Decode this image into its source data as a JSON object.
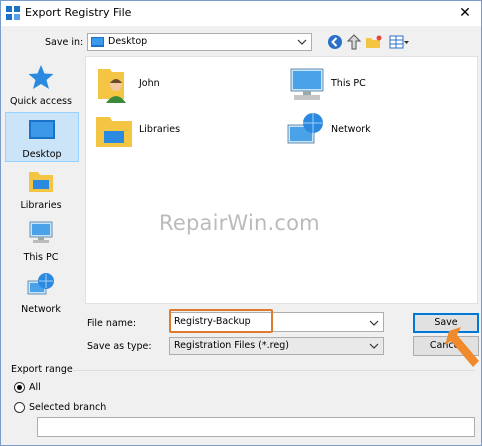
{
  "window": {
    "title": "Export Registry File",
    "close_glyph": "✕"
  },
  "toolbar": {
    "save_in_label": "Save in:",
    "save_in_value": "Desktop",
    "icons": [
      "back-icon",
      "up-folder-icon",
      "new-folder-icon",
      "view-menu-icon"
    ]
  },
  "places": [
    {
      "label": "Quick access",
      "icon": "star-icon"
    },
    {
      "label": "Desktop",
      "icon": "desktop-icon",
      "selected": true
    },
    {
      "label": "Libraries",
      "icon": "libraries-icon"
    },
    {
      "label": "This PC",
      "icon": "computer-icon"
    },
    {
      "label": "Network",
      "icon": "network-icon"
    }
  ],
  "files": [
    {
      "label": "John",
      "icon": "user-folder-icon"
    },
    {
      "label": "This PC",
      "icon": "computer-icon"
    },
    {
      "label": "Libraries",
      "icon": "libraries-icon"
    },
    {
      "label": "Network",
      "icon": "network-icon"
    }
  ],
  "watermark": "RepairWin.com",
  "form": {
    "file_name_label": "File name:",
    "file_name_value": "Registry-Backup",
    "save_as_type_label": "Save as type:",
    "save_as_type_value": "Registration Files (*.reg)",
    "save_button": "Save",
    "cancel_button": "Cancel"
  },
  "export_range": {
    "title": "Export range",
    "all_label": "All",
    "selected_branch_label": "Selected branch",
    "selected": "All",
    "branch_value": ""
  },
  "colors": {
    "accent": "#0078d7",
    "highlight": "#e07a2e",
    "selected_place_bg": "#cce4f7"
  }
}
